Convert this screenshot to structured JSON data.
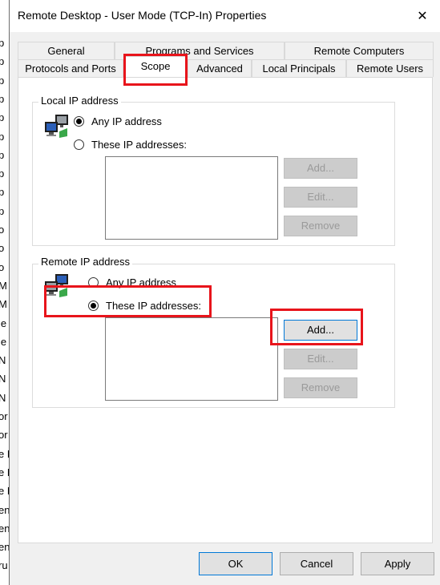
{
  "background_window": {
    "visible_letters": [
      "p",
      "p",
      "p",
      "p",
      "p",
      "p",
      "p",
      "p",
      "p",
      "p",
      "o",
      "o",
      "o",
      "M",
      "M",
      "le",
      "le",
      "N",
      "N",
      "N",
      "or",
      "or",
      "e N",
      "e N",
      "e N",
      "en",
      "en",
      "en",
      "ru"
    ]
  },
  "dialog": {
    "title": "Remote Desktop - User Mode (TCP-In) Properties",
    "close_glyph": "✕"
  },
  "tabs": {
    "row1": [
      "General",
      "Programs and Services",
      "Remote Computers"
    ],
    "row2": [
      "Protocols and Ports",
      "Scope",
      "Advanced",
      "Local Principals",
      "Remote Users"
    ],
    "active": "Scope"
  },
  "local_ip": {
    "group_label": "Local IP address",
    "option_any": "Any IP address",
    "option_these": "These IP addresses:",
    "selected": "any",
    "buttons": {
      "add": "Add...",
      "edit": "Edit...",
      "remove": "Remove"
    }
  },
  "remote_ip": {
    "group_label": "Remote IP address",
    "option_any": "Any IP address",
    "option_these": "These IP addresses:",
    "selected": "these",
    "buttons": {
      "add": "Add...",
      "edit": "Edit...",
      "remove": "Remove"
    }
  },
  "footer": {
    "ok": "OK",
    "cancel": "Cancel",
    "apply": "Apply"
  },
  "colors": {
    "highlight": "#e8141b",
    "dialog_bg": "#f0f0f0",
    "focus_border": "#0078d7"
  }
}
